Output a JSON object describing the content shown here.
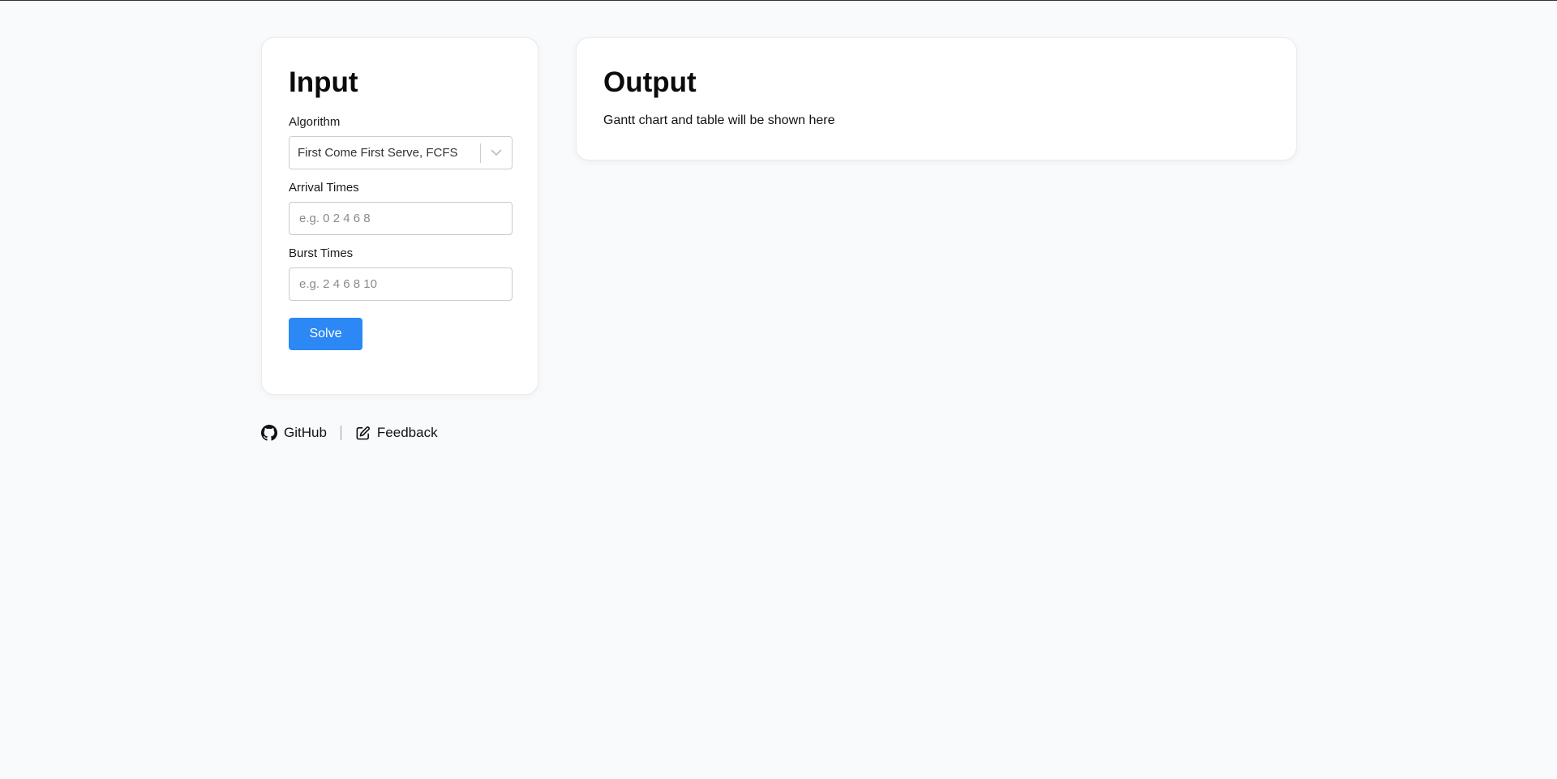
{
  "input_card": {
    "title": "Input",
    "algorithm": {
      "label": "Algorithm",
      "selected": "First Come First Serve, FCFS"
    },
    "arrival_times": {
      "label": "Arrival Times",
      "value": "",
      "placeholder": "e.g. 0 2 4 6 8"
    },
    "burst_times": {
      "label": "Burst Times",
      "value": "",
      "placeholder": "e.g. 2 4 6 8 10"
    },
    "solve_label": "Solve"
  },
  "output_card": {
    "title": "Output",
    "message": "Gantt chart and table will be shown here"
  },
  "footer": {
    "github_label": "GitHub",
    "github_icon": "github-icon",
    "feedback_label": "Feedback",
    "feedback_icon": "edit-icon"
  },
  "colors": {
    "background": "#f9fafb",
    "card": "#ffffff",
    "primary_button": "#2b88f5"
  }
}
